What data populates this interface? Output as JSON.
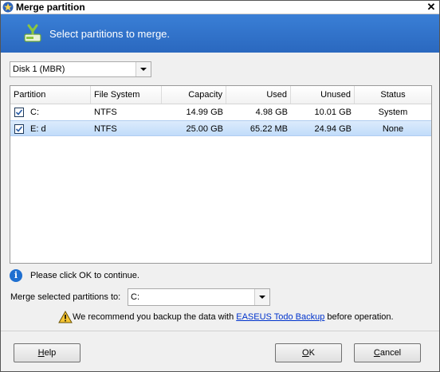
{
  "window": {
    "title": "Merge partition",
    "close_glyph": "✕"
  },
  "banner": {
    "text": "Select partitions to merge.",
    "icon": "merge-disk-icon"
  },
  "disk_select": {
    "value": "Disk 1 (MBR)"
  },
  "table": {
    "columns": [
      "Partition",
      "File System",
      "Capacity",
      "Used",
      "Unused",
      "Status"
    ],
    "rows": [
      {
        "checked": true,
        "partition": "C:",
        "fs": "NTFS",
        "capacity": "14.99 GB",
        "used": "4.98 GB",
        "unused": "10.01 GB",
        "status": "System",
        "selected": false
      },
      {
        "checked": true,
        "partition": "E: d",
        "fs": "NTFS",
        "capacity": "25.00 GB",
        "used": "65.22 MB",
        "unused": "24.94 GB",
        "status": "None",
        "selected": true
      }
    ]
  },
  "info": {
    "text": "Please click OK to continue.",
    "icon": "info-icon"
  },
  "merge_to": {
    "label": "Merge selected partitions to:",
    "value": "C:"
  },
  "warning": {
    "prefix": "We recommend you backup the data with ",
    "link": "EASEUS Todo Backup",
    "suffix": " before operation.",
    "icon": "warning-icon"
  },
  "buttons": {
    "help": {
      "first": "H",
      "rest": "elp"
    },
    "ok": {
      "first": "O",
      "rest": "K"
    },
    "cancel": {
      "first": "C",
      "rest": "ancel"
    }
  },
  "colors": {
    "banner": "#2f72cc",
    "selection": "#cce2fb",
    "link": "#0033cc"
  }
}
